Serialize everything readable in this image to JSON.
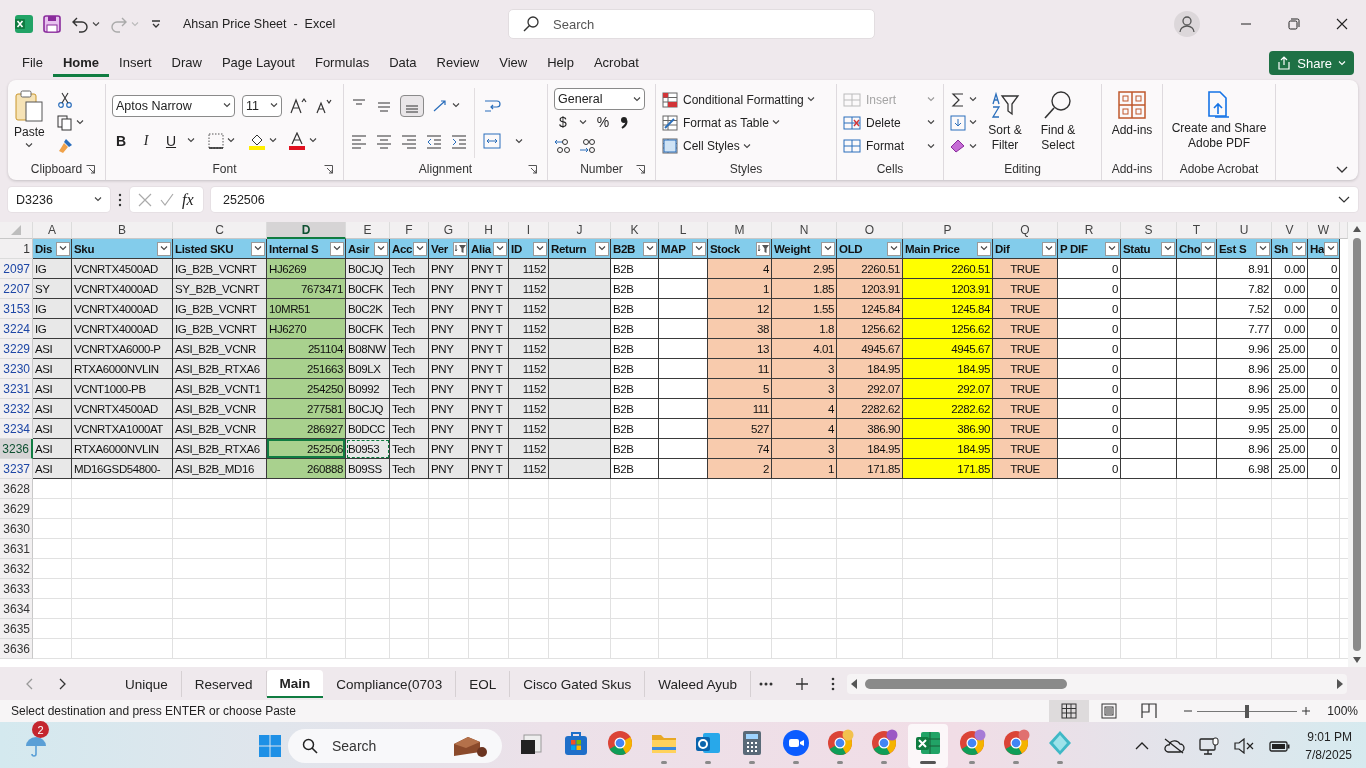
{
  "window": {
    "title": "Ahsan Price Sheet  -  Excel"
  },
  "search": {
    "placeholder": "Search"
  },
  "menu_tabs": [
    {
      "label": "File",
      "selected": false
    },
    {
      "label": "Home",
      "selected": true
    },
    {
      "label": "Insert",
      "selected": false
    },
    {
      "label": "Draw",
      "selected": false
    },
    {
      "label": "Page Layout",
      "selected": false
    },
    {
      "label": "Formulas",
      "selected": false
    },
    {
      "label": "Data",
      "selected": false
    },
    {
      "label": "Review",
      "selected": false
    },
    {
      "label": "View",
      "selected": false
    },
    {
      "label": "Help",
      "selected": false
    },
    {
      "label": "Acrobat",
      "selected": false
    }
  ],
  "share_button": {
    "label": "Share"
  },
  "ribbon": {
    "clipboard": {
      "name": "Clipboard",
      "paste": "Paste"
    },
    "font": {
      "name": "Font",
      "family": "Aptos Narrow",
      "size": "11",
      "bold": "B",
      "italic": "I",
      "underline": "U"
    },
    "alignment": {
      "name": "Alignment"
    },
    "number": {
      "name": "Number",
      "format": "General",
      "currency": "$",
      "percent": "%"
    },
    "styles": {
      "name": "Styles",
      "items": [
        {
          "label": "Conditional Formatting"
        },
        {
          "label": "Format as Table"
        },
        {
          "label": "Cell Styles"
        }
      ]
    },
    "cells": {
      "name": "Cells",
      "items": [
        {
          "label": "Insert",
          "disabled": true
        },
        {
          "label": "Delete",
          "disabled": false
        },
        {
          "label": "Format",
          "disabled": false
        }
      ]
    },
    "editing": {
      "name": "Editing",
      "sort": "Sort & Filter",
      "find": "Find & Select"
    },
    "addins": {
      "name": "Add-ins",
      "button": "Add-ins"
    },
    "acrobat": {
      "name": "Adobe Acrobat",
      "button": "Create and Share Adobe PDF"
    }
  },
  "formula_bar": {
    "name_box": "D3236",
    "function_button": "fx",
    "value": "252506"
  },
  "sheet": {
    "header_row": {
      "number": "1"
    },
    "columns": [
      {
        "letter": "A",
        "header": "Dis",
        "color": "#e8e8e8",
        "kind": "data",
        "filtered": false,
        "selected": false,
        "copied": false
      },
      {
        "letter": "B",
        "header": "Sku",
        "color": "#e8e8e8",
        "kind": "data",
        "filtered": false,
        "selected": false,
        "copied": false
      },
      {
        "letter": "C",
        "header": "Listed SKU",
        "color": "#e8e8e8",
        "kind": "data",
        "filtered": false,
        "selected": false,
        "copied": false
      },
      {
        "letter": "D",
        "header": "Internal S",
        "color": "#a9d18e",
        "kind": "data",
        "filtered": false,
        "selected": true,
        "copied": false
      },
      {
        "letter": "E",
        "header": "Asir",
        "color": "#e8e8e8",
        "kind": "data",
        "filtered": false,
        "selected": false,
        "copied": true
      },
      {
        "letter": "F",
        "header": "Acc",
        "color": "#e8e8e8",
        "kind": "data",
        "filtered": false,
        "selected": false,
        "copied": false
      },
      {
        "letter": "G",
        "header": "Ver",
        "color": "#e8e8e8",
        "kind": "data",
        "filtered": true,
        "selected": false,
        "copied": false
      },
      {
        "letter": "H",
        "header": "Alia",
        "color": "#e8e8e8",
        "kind": "data",
        "filtered": false,
        "selected": false,
        "copied": false
      },
      {
        "letter": "I",
        "header": "ID",
        "color": "#e8e8e8",
        "kind": "data",
        "filtered": false,
        "selected": false,
        "copied": false
      },
      {
        "letter": "J",
        "header": "Return",
        "color": "#e8e8e8",
        "kind": "data",
        "filtered": false,
        "selected": false,
        "copied": false
      },
      {
        "letter": "K",
        "header": "B2B",
        "color": "#ffffff",
        "kind": "data",
        "filtered": false,
        "selected": false,
        "copied": false
      },
      {
        "letter": "L",
        "header": "MAP",
        "color": "#ffffff",
        "kind": "data",
        "filtered": false,
        "selected": false,
        "copied": false
      },
      {
        "letter": "M",
        "header": "Stock",
        "color": "#f8cbad",
        "kind": "data",
        "filtered": true,
        "selected": false,
        "copied": false
      },
      {
        "letter": "N",
        "header": "Weight",
        "color": "#f8cbad",
        "kind": "data",
        "filtered": false,
        "selected": false,
        "copied": false
      },
      {
        "letter": "O",
        "header": "OLD",
        "color": "#f8cbad",
        "kind": "data",
        "filtered": false,
        "selected": false,
        "copied": false
      },
      {
        "letter": "P",
        "header": "Main Price",
        "color": "#ffff00",
        "kind": "data",
        "filtered": false,
        "selected": false,
        "copied": false
      },
      {
        "letter": "Q",
        "header": "Dif",
        "color": "#f8cbad",
        "kind": "flag",
        "filtered": false,
        "selected": false,
        "copied": false
      },
      {
        "letter": "R",
        "header": "P DIF",
        "color": "#ffffff",
        "kind": "data",
        "filtered": false,
        "selected": false,
        "copied": false
      },
      {
        "letter": "S",
        "header": "Statu",
        "color": "#ffffff",
        "kind": "data",
        "filtered": false,
        "selected": false,
        "copied": false
      },
      {
        "letter": "T",
        "header": "Cho",
        "color": "#ffffff",
        "kind": "data",
        "filtered": false,
        "selected": false,
        "copied": false
      },
      {
        "letter": "U",
        "header": "Est S",
        "color": "#ffffff",
        "kind": "data",
        "filtered": false,
        "selected": false,
        "copied": false
      },
      {
        "letter": "V",
        "header": "Sh",
        "color": "#ffffff",
        "kind": "data",
        "filtered": false,
        "selected": false,
        "copied": false
      },
      {
        "letter": "W",
        "header": "Ha",
        "color": "#ffffff",
        "kind": "data",
        "filtered": false,
        "selected": false,
        "copied": false
      }
    ],
    "rows": [
      {
        "number": "2097",
        "filtered": true,
        "selected": false,
        "copied": false,
        "cells": [
          "IG",
          "VCNRTX4500AD",
          "IG_B2B_VCNRT",
          "HJ6269",
          "B0CJQ",
          "Tech",
          "PNY",
          "PNY T",
          "1152",
          null,
          "B2B",
          null,
          "4",
          "2.95",
          "2260.51",
          "2260.51",
          "TRUE",
          "0",
          null,
          null,
          "8.91",
          "0.00",
          "0"
        ]
      },
      {
        "number": "2207",
        "filtered": true,
        "selected": false,
        "copied": false,
        "cells": [
          "SY",
          "VCNRTX4000AD",
          "SY_B2B_VCNRT",
          "7673471",
          "B0CFK",
          "Tech",
          "PNY",
          "PNY T",
          "1152",
          null,
          "B2B",
          null,
          "1",
          "1.85",
          "1203.91",
          "1203.91",
          "TRUE",
          "0",
          null,
          null,
          "7.82",
          "0.00",
          "0"
        ]
      },
      {
        "number": "3153",
        "filtered": true,
        "selected": false,
        "copied": false,
        "cells": [
          "IG",
          "VCNRTX4000AD",
          "IG_B2B_VCNRT",
          "10MR51",
          "B0C2K",
          "Tech",
          "PNY",
          "PNY T",
          "1152",
          null,
          "B2B",
          null,
          "12",
          "1.55",
          "1245.84",
          "1245.84",
          "TRUE",
          "0",
          null,
          null,
          "7.52",
          "0.00",
          "0"
        ]
      },
      {
        "number": "3224",
        "filtered": true,
        "selected": false,
        "copied": false,
        "cells": [
          "IG",
          "VCNRTX4000AD",
          "IG_B2B_VCNRT",
          "HJ6270",
          "B0CFK",
          "Tech",
          "PNY",
          "PNY T",
          "1152",
          null,
          "B2B",
          null,
          "38",
          "1.8",
          "1256.62",
          "1256.62",
          "TRUE",
          "0",
          null,
          null,
          "7.77",
          "0.00",
          "0"
        ]
      },
      {
        "number": "3229",
        "filtered": true,
        "selected": false,
        "copied": false,
        "cells": [
          "ASI",
          "VCNRTXA6000-P",
          "ASI_B2B_VCNR",
          "251104",
          "B08NW",
          "Tech",
          "PNY",
          "PNY T",
          "1152",
          null,
          "B2B",
          null,
          "13",
          "4.01",
          "4945.67",
          "4945.67",
          "TRUE",
          "0",
          null,
          null,
          "9.96",
          "25.00",
          "0"
        ]
      },
      {
        "number": "3230",
        "filtered": true,
        "selected": false,
        "copied": false,
        "cells": [
          "ASI",
          "RTXA6000NVLIN",
          "ASI_B2B_RTXA6",
          "251663",
          "B09LX",
          "Tech",
          "PNY",
          "PNY T",
          "1152",
          null,
          "B2B",
          null,
          "11",
          "3",
          "184.95",
          "184.95",
          "TRUE",
          "0",
          null,
          null,
          "8.96",
          "25.00",
          "0"
        ]
      },
      {
        "number": "3231",
        "filtered": true,
        "selected": false,
        "copied": false,
        "cells": [
          "ASI",
          "VCNT1000-PB",
          "ASI_B2B_VCNT1",
          "254250",
          "B0992",
          "Tech",
          "PNY",
          "PNY T",
          "1152",
          null,
          "B2B",
          null,
          "5",
          "3",
          "292.07",
          "292.07",
          "TRUE",
          "0",
          null,
          null,
          "8.96",
          "25.00",
          "0"
        ]
      },
      {
        "number": "3232",
        "filtered": true,
        "selected": false,
        "copied": false,
        "cells": [
          "ASI",
          "VCNRTX4500AD",
          "ASI_B2B_VCNR",
          "277581",
          "B0CJQ",
          "Tech",
          "PNY",
          "PNY T",
          "1152",
          null,
          "B2B",
          null,
          "111",
          "4",
          "2282.62",
          "2282.62",
          "TRUE",
          "0",
          null,
          null,
          "9.95",
          "25.00",
          "0"
        ]
      },
      {
        "number": "3234",
        "filtered": true,
        "selected": false,
        "copied": false,
        "cells": [
          "ASI",
          "VCNRTXA1000AT",
          "ASI_B2B_VCNR",
          "286927",
          "B0DCC",
          "Tech",
          "PNY",
          "PNY T",
          "1152",
          null,
          "B2B",
          null,
          "527",
          "4",
          "386.90",
          "386.90",
          "TRUE",
          "0",
          null,
          null,
          "9.95",
          "25.00",
          "0"
        ]
      },
      {
        "number": "3236",
        "filtered": true,
        "selected": true,
        "copied": true,
        "cells": [
          "ASI",
          "RTXA6000NVLIN",
          "ASI_B2B_RTXA6",
          "252506",
          "B0953",
          "Tech",
          "PNY",
          "PNY T",
          "1152",
          null,
          "B2B",
          null,
          "74",
          "3",
          "184.95",
          "184.95",
          "TRUE",
          "0",
          null,
          null,
          "8.96",
          "25.00",
          "0"
        ]
      },
      {
        "number": "3237",
        "filtered": true,
        "selected": false,
        "copied": false,
        "cells": [
          "ASI",
          "MD16GSD54800-",
          "ASI_B2B_MD16",
          "260888",
          "B09SS",
          "Tech",
          "PNY",
          "PNY T",
          "1152",
          null,
          "B2B",
          null,
          "2",
          "1",
          "171.85",
          "171.85",
          "TRUE",
          "0",
          null,
          null,
          "6.98",
          "25.00",
          "0"
        ]
      },
      {
        "number": "3628",
        "filtered": false,
        "selected": false
      },
      {
        "number": "3629",
        "filtered": false,
        "selected": false
      },
      {
        "number": "3630",
        "filtered": false,
        "selected": false
      },
      {
        "number": "3631",
        "filtered": false,
        "selected": false
      },
      {
        "number": "3632",
        "filtered": false,
        "selected": false
      },
      {
        "number": "3633",
        "filtered": false,
        "selected": false
      },
      {
        "number": "3634",
        "filtered": false,
        "selected": false
      },
      {
        "number": "3635",
        "filtered": false,
        "selected": false
      },
      {
        "number": "3636",
        "filtered": false,
        "selected": false
      }
    ]
  },
  "sheet_tabs": [
    {
      "label": "Unique",
      "selected": false
    },
    {
      "label": "Reserved",
      "selected": false
    },
    {
      "label": "Main",
      "selected": true
    },
    {
      "label": "Compliance(0703",
      "selected": false
    },
    {
      "label": "EOL",
      "selected": false
    },
    {
      "label": "Cisco Gated Skus",
      "selected": false
    },
    {
      "label": "Waleed Ayub",
      "selected": false
    }
  ],
  "status_bar": {
    "message": "Select destination and press ENTER or choose Paste",
    "views": [
      {
        "kind": "normal",
        "selected": true
      },
      {
        "kind": "page_layout",
        "selected": false
      },
      {
        "kind": "page_break",
        "selected": false
      }
    ],
    "zoom": {
      "level": 0.5,
      "reading": "100%"
    }
  },
  "taskbar": {
    "weather_badge": "2",
    "search": {
      "placeholder": "Search"
    },
    "apps": [
      {
        "kind": "window",
        "running": false,
        "active": false
      },
      {
        "kind": "store",
        "running": false,
        "active": false
      },
      {
        "kind": "chrome",
        "running": false,
        "active": false
      },
      {
        "kind": "explorer",
        "running": true,
        "active": false
      },
      {
        "kind": "outlook",
        "running": true,
        "active": false
      },
      {
        "kind": "calculator",
        "running": true,
        "active": false
      },
      {
        "kind": "zoom",
        "running": true,
        "active": false
      },
      {
        "kind": "chrome",
        "color": "#f2c14e",
        "running": true,
        "active": false
      },
      {
        "kind": "chrome",
        "color": "#9b59c4",
        "running": true,
        "active": false
      },
      {
        "kind": "excel",
        "running": true,
        "active": true
      },
      {
        "kind": "chrome",
        "color": "#a77bd6",
        "running": true,
        "active": false
      },
      {
        "kind": "chrome",
        "color": "#e07070",
        "running": true,
        "active": false
      },
      {
        "kind": "diamond",
        "running": true,
        "active": false
      }
    ],
    "clock": {
      "time": "9:01 PM",
      "date": "7/8/2025"
    }
  }
}
